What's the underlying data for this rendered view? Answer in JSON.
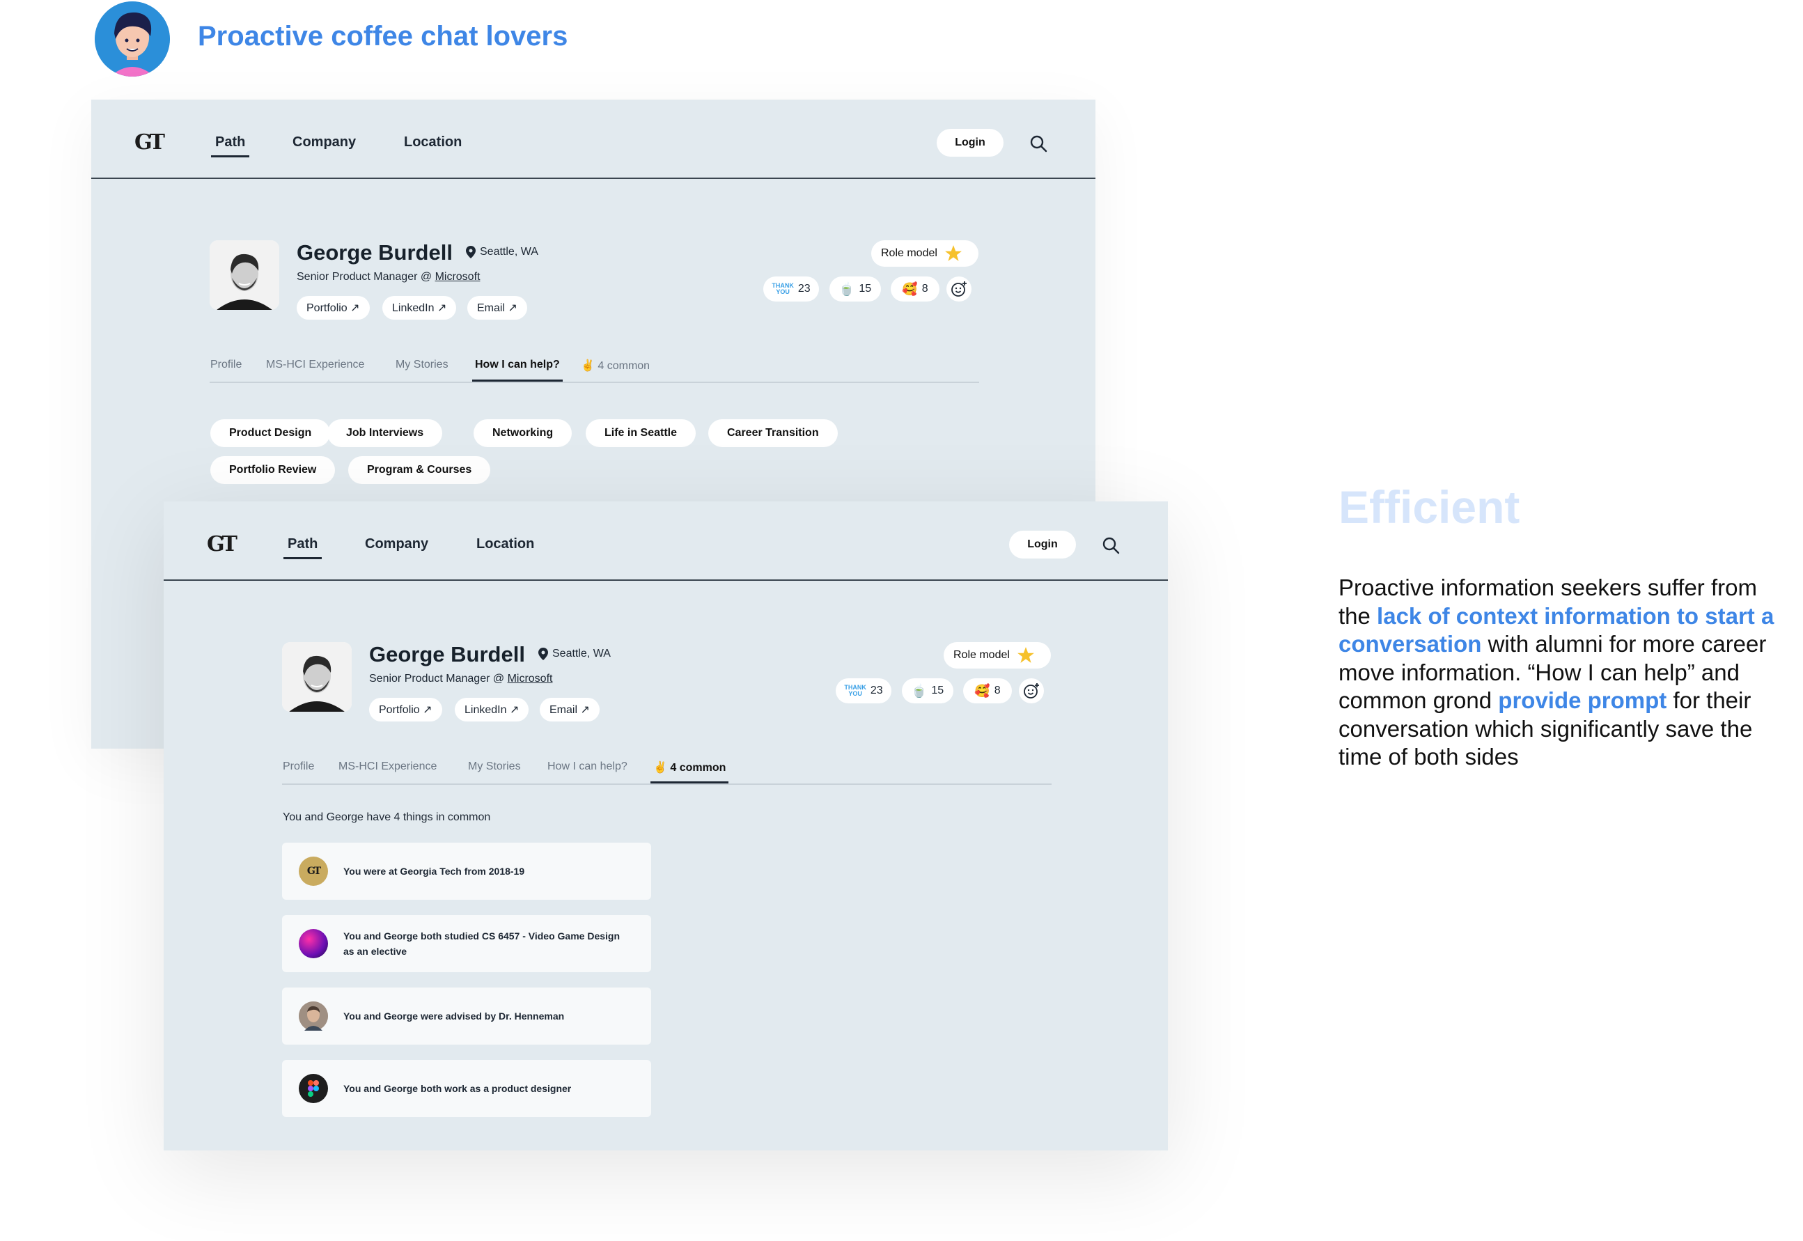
{
  "persona": {
    "title": "Proactive coffee chat lovers"
  },
  "nav": {
    "logo": "GT",
    "links": [
      "Path",
      "Company",
      "Location"
    ],
    "login": "Login"
  },
  "profile": {
    "name": "George Burdell",
    "location": "Seattle, WA",
    "role_prefix": "Senior Product Manager @ ",
    "company": "Microsoft",
    "links": [
      "Portfolio ↗",
      "LinkedIn ↗",
      "Email ↗"
    ],
    "badge": "Role model",
    "reactions": [
      {
        "icon": "thank-you-sticker",
        "label": "THANK YOU",
        "count": "23"
      },
      {
        "icon": "coffee-cup-icon",
        "count": "15"
      },
      {
        "icon": "love-face-icon",
        "count": "8"
      }
    ]
  },
  "tabs": [
    "Profile",
    "MS-HCI Experience",
    "My Stories",
    "How I can help?",
    "4 common"
  ],
  "help_topics": [
    "Product Design",
    "Job Interviews",
    "Networking",
    "Life in Seattle",
    "Career Transition",
    "Portfolio Review",
    "Program & Courses"
  ],
  "common": {
    "intro": "You and George have 4 things in common",
    "items": [
      {
        "icon": "georgia-tech-logo",
        "text": "You were at Georgia Tech from 2018-19"
      },
      {
        "icon": "game-course-icon",
        "text": "You and George both studied CS 6457 - Video Game Design as an elective"
      },
      {
        "icon": "advisor-avatar",
        "text": "You and George were advised by Dr. Henneman"
      },
      {
        "icon": "figma-icon",
        "text": "You and George both work as a product designer"
      }
    ]
  },
  "right_panel": {
    "title": "Efficient",
    "body_1": "Proactive information seekers suffer from the ",
    "highlight_1": "lack of context information to start a conversation",
    "body_2": " with alumni for more career move information. “How I can help” and common grond ",
    "highlight_2": "provide prompt",
    "body_3": " for their conversation which significantly save the time of both sides"
  },
  "colors": {
    "accent": "#3e86e6",
    "accent_light": "#d6e5fb",
    "mockup_bg": "#e2eaef",
    "star": "#f6c12b"
  }
}
